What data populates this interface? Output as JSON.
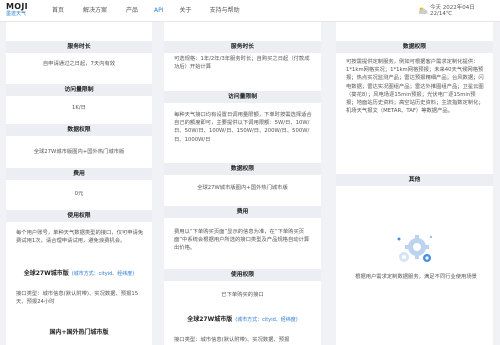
{
  "brand": {
    "logo_main": "MOJI",
    "logo_sub": "墨迹天气"
  },
  "nav": [
    {
      "label": "首页"
    },
    {
      "label": "解决方案"
    },
    {
      "label": "产品"
    },
    {
      "label": "API"
    },
    {
      "label": "关于"
    },
    {
      "label": "支持与帮助"
    }
  ],
  "weather": {
    "today": "今天 2022年04日",
    "temp": "22/14℃"
  },
  "col1": {
    "service_period": {
      "head": "服务时长",
      "text": "自申请通过之日起，7天内有效"
    },
    "access_limit": {
      "head": "访问量限制",
      "text": "1K/日"
    },
    "data_permission": {
      "head": "数据权限",
      "text": "全球27W城市版图内+国外热门城市版"
    },
    "cost": {
      "head": "费用",
      "text": "0元"
    },
    "usage": {
      "head": "使用权限",
      "text": "每个用户账号，单种天气数据类型的接口，仅可申请免费试用1次，请合理申请试用，避免浪费机会。"
    },
    "global_version": {
      "title": "全球27W城市版",
      "tag": "(城市方式：cityid、经纬度)"
    },
    "interface_type": {
      "text": "接口类型：城市信息(默认附带)、实况数据、预报15天、预报24小时"
    },
    "domestic_version": {
      "title": "国内+国外热门城市版"
    }
  },
  "col2": {
    "intro": {
      "text": "可选规格：1年/2年/3年服务时长；自购买之日起（付款成功后）开始计算"
    },
    "service_period": {
      "head": "服务时长"
    },
    "access_limit": {
      "head": "访问量限制",
      "text": "每种天气接口均有设置日调用量限额，下单时按需选择适合自己的额度即可，主要提供以下调用限额：5W/日、10W/日、50W/日、100W/日、150W/日、200W/日、500W/日、1000W/日"
    },
    "data_permission": {
      "head": "数据权限",
      "text": "全球27W城市版图内+国外热门城市版"
    },
    "cost": {
      "head": "费用",
      "text": "费用以“下单购买页面”显示的信息为准，在“下单购买页面”中系统会根据用户所选的接口类型及产品规格自动计算出价格。"
    },
    "usage": {
      "head": "使用权限",
      "text": "已下单购买的接口"
    },
    "global_version": {
      "title": "全球27W城市版",
      "tag": "(城市方式：cityid、经纬度)"
    },
    "interface_type": {
      "text": "接口类型：城市信息(默认附带)、实况数据、预报"
    }
  },
  "col3": {
    "data_permission": {
      "head": "数据权限",
      "text": "可按需提供定制服务，例如可根据客户需求定制化提供：1*1km网格实况；1*1km网格预报；未来40天气候网格预报；热点实况监测产品；雷达预报精细产品；台风数据；闪电数据；雷达实况图组产品；雷达外推图组产品；卫星云图（葵花8）；风电场逐15min预报；光伏电厂逐15min预报；地面站历史资料；高空站历史资料；主流指数定制化；机场天气报文（METAR、TAF）等数据产品。"
    },
    "other": {
      "head": "其他",
      "text": "根据用户需求定制数据服务，满足不同行业使用场景"
    }
  },
  "illustration": {
    "name": "gear-cluster-illustration"
  }
}
